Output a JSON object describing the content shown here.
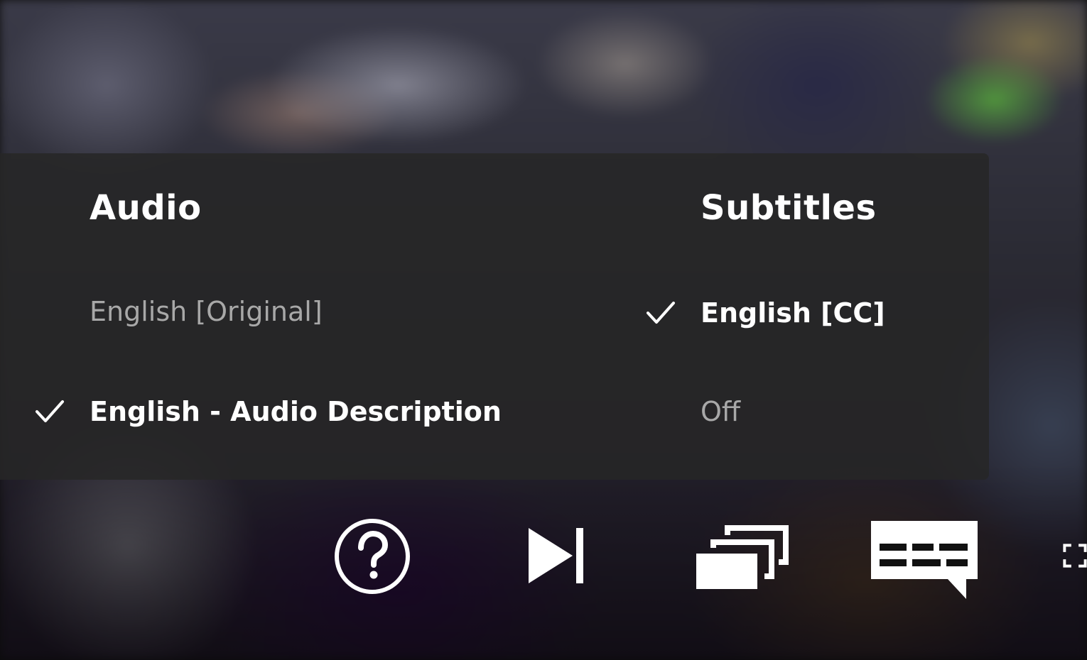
{
  "audio": {
    "heading": "Audio",
    "options": [
      {
        "label": "English [Original]",
        "selected": false
      },
      {
        "label": "English - Audio Description",
        "selected": true
      }
    ]
  },
  "subtitles": {
    "heading": "Subtitles",
    "options": [
      {
        "label": "English [CC]",
        "selected": true
      },
      {
        "label": "Off",
        "selected": false
      }
    ]
  },
  "controls": [
    {
      "icon": "help-icon"
    },
    {
      "icon": "next-episode-icon"
    },
    {
      "icon": "episodes-icon"
    },
    {
      "icon": "subtitles-icon"
    },
    {
      "icon": "fullscreen-icon"
    }
  ],
  "colors": {
    "panel_bg": "#262626",
    "text_selected": "#ffffff",
    "text_unselected": "#a8a8a8"
  }
}
